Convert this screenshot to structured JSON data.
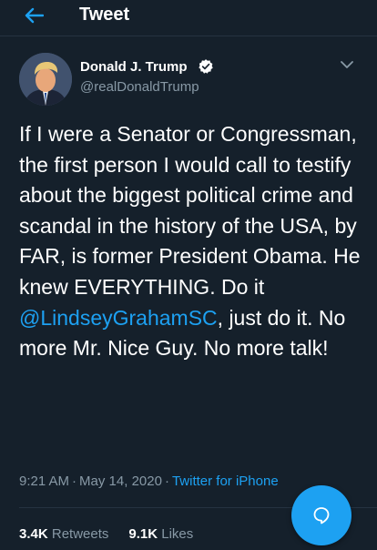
{
  "header": {
    "title": "Tweet",
    "back_icon": "arrow-left-icon"
  },
  "author": {
    "name": "Donald J. Trump",
    "handle": "@realDonaldTrump",
    "verified": true,
    "verified_icon": "verified-badge-icon",
    "menu_icon": "chevron-down-icon"
  },
  "tweet": {
    "text_before": "If I were a Senator or Congressman, the first person I would call to testify about the biggest political crime and scandal in the history of the USA, by FAR, is former President Obama. He knew EVERYTHING. Do it ",
    "mention": "@LindseyGrahamSC",
    "text_after": ", just do it. No more Mr. Nice Guy. No more talk!"
  },
  "meta": {
    "time": "9:21 AM",
    "date": "May 14, 2020",
    "separator": "·",
    "source": "Twitter for iPhone"
  },
  "stats": {
    "retweets_count": "3.4K",
    "retweets_label": "Retweets",
    "likes_count": "9.1K",
    "likes_label": "Likes"
  },
  "fab": {
    "icon": "reply-bubble-icon"
  },
  "colors": {
    "background": "#15202b",
    "accent": "#1da1f2",
    "muted": "#8899a6",
    "divider": "#253341"
  }
}
